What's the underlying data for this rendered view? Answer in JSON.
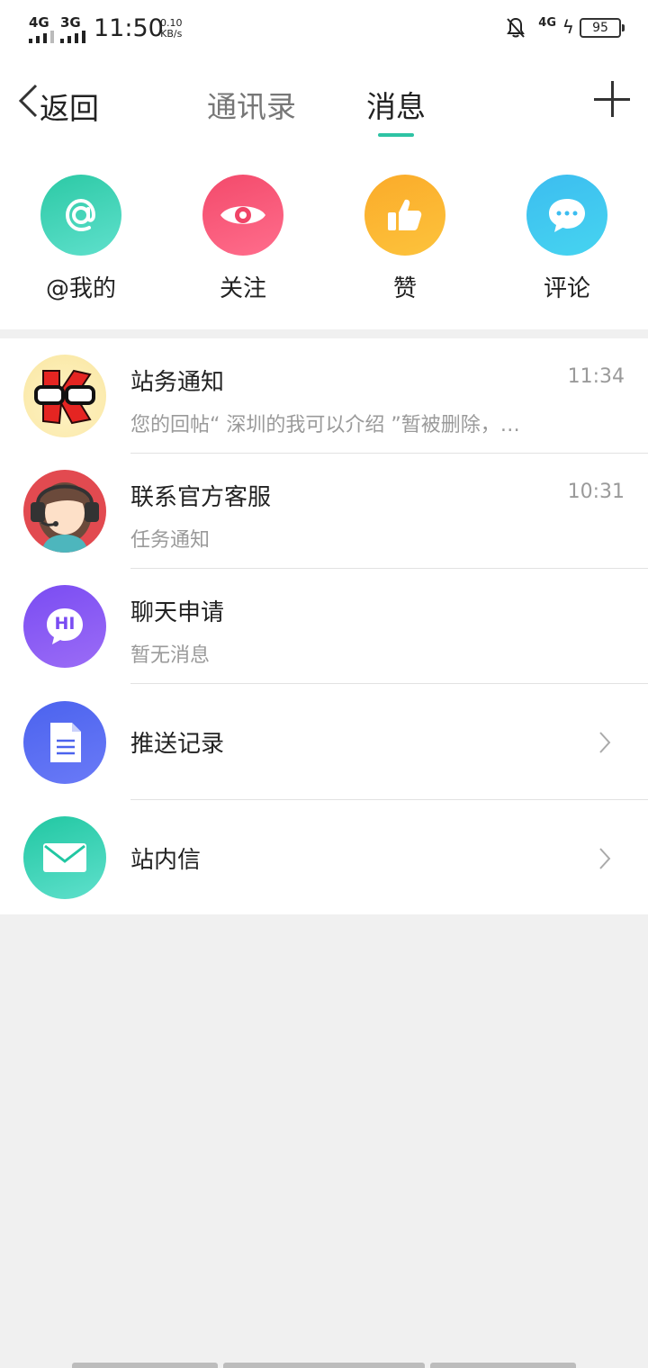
{
  "status_bar": {
    "sim1": "4G",
    "sim2": "3G",
    "time": "11:50",
    "speed_value": "0.10",
    "speed_unit": "KB/s",
    "network": "4G",
    "battery": "95"
  },
  "nav": {
    "back_label": "返回",
    "tabs": [
      "通讯录",
      "消息"
    ],
    "active_tab": "消息",
    "accent": "#2ec3a4"
  },
  "quick": [
    {
      "label": "@我的",
      "icon": "at-icon"
    },
    {
      "label": "关注",
      "icon": "eye-icon"
    },
    {
      "label": "赞",
      "icon": "thumbs-up-icon"
    },
    {
      "label": "评论",
      "icon": "comment-icon"
    }
  ],
  "messages": [
    {
      "title": "站务通知",
      "preview": "您的回帖“ 深圳的我可以介绍 ”暂被删除，…",
      "time": "11:34"
    },
    {
      "title": "联系官方客服",
      "preview": "任务通知",
      "time": "10:31"
    },
    {
      "title": "聊天申请",
      "preview": "暂无消息",
      "time": "",
      "badge": "HI"
    }
  ],
  "links": [
    {
      "title": "推送记录",
      "icon": "document-icon"
    },
    {
      "title": "站内信",
      "icon": "mail-icon"
    }
  ]
}
